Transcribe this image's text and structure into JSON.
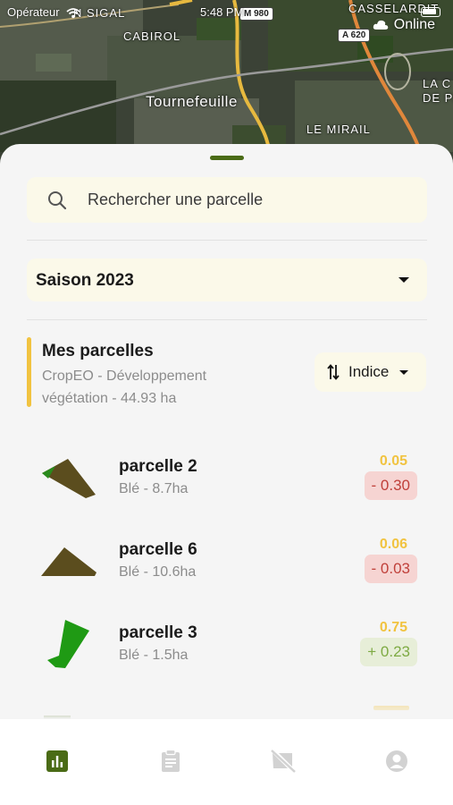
{
  "status_bar": {
    "carrier": "Opérateur",
    "time": "5:48 PM"
  },
  "connection": {
    "status": "Online"
  },
  "map": {
    "labels": [
      "N SIGAL",
      "CABIROL",
      "Tournefeuille",
      "LE MIRAIL",
      "CASSELARDIT",
      "LA C",
      "DE PE"
    ],
    "shields": [
      "M 980",
      "A 620"
    ]
  },
  "search": {
    "placeholder": "Rechercher une parcelle"
  },
  "season": {
    "selected": "Saison 2023"
  },
  "group": {
    "title": "Mes parcelles",
    "subtitle": "CropEO - Développement végétation - 44.93 ha",
    "sort_label": "Indice"
  },
  "parcels": [
    {
      "name": "parcelle 2",
      "meta": "Blé - 8.7ha",
      "value": "0.05",
      "delta": "- 0.30",
      "trend": "negative"
    },
    {
      "name": "parcelle 6",
      "meta": "Blé - 10.6ha",
      "value": "0.06",
      "delta": "- 0.03",
      "trend": "negative"
    },
    {
      "name": "parcelle 3",
      "meta": "Blé - 1.5ha",
      "value": "0.75",
      "delta": "+ 0.23",
      "trend": "positive"
    }
  ],
  "colors": {
    "accent_green": "#4a6b16",
    "highlight_yellow": "#f1c340",
    "negative_red": "#c0403a",
    "positive_green": "#7eaa43",
    "field_fill": "#fbf9e9"
  },
  "tabs": [
    {
      "icon": "chart-bar-icon",
      "active": true
    },
    {
      "icon": "clipboard-icon",
      "active": false
    },
    {
      "icon": "satellite-off-icon",
      "active": false
    },
    {
      "icon": "account-icon",
      "active": false
    }
  ]
}
